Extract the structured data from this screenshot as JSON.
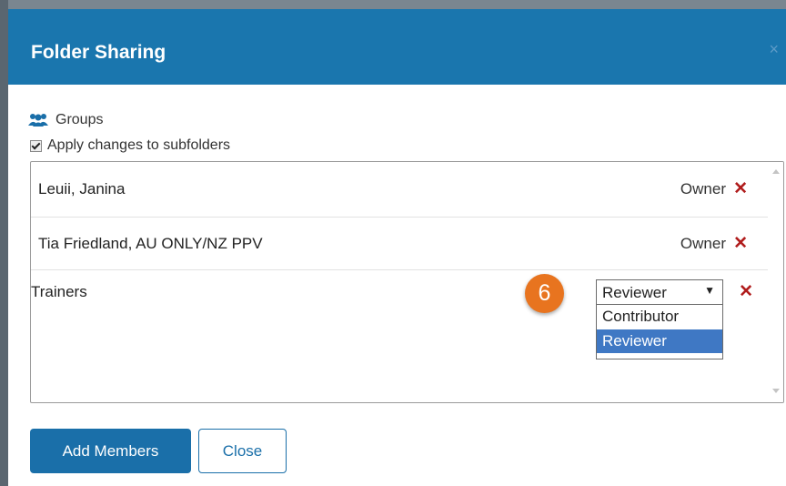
{
  "dialog": {
    "title": "Folder Sharing",
    "close_glyph": "×"
  },
  "groups_label": "Groups",
  "apply_changes_label": "Apply changes to subfolders",
  "apply_changes_checked": true,
  "members": [
    {
      "name": "Leuii, Janina",
      "role": "Owner"
    },
    {
      "name": "Tia Friedland, AU ONLY/NZ PPV",
      "role": "Owner"
    },
    {
      "name": "Trainers",
      "role": "Reviewer"
    }
  ],
  "role_select": {
    "current_value": "Reviewer",
    "options": [
      "Contributor",
      "Reviewer"
    ],
    "highlighted_option": "Reviewer"
  },
  "step_badge": "6",
  "buttons": {
    "add_members": "Add Members",
    "close": "Close"
  },
  "colors": {
    "header": "#1a76ae",
    "primary_button": "#1a6fa9",
    "remove_icon": "#b01c1c",
    "step_badge": "#e8741f",
    "highlight": "#3f78c4"
  },
  "icons": {
    "groups": "users-icon",
    "remove": "remove-x-icon",
    "dropdown": "caret-down-icon"
  }
}
